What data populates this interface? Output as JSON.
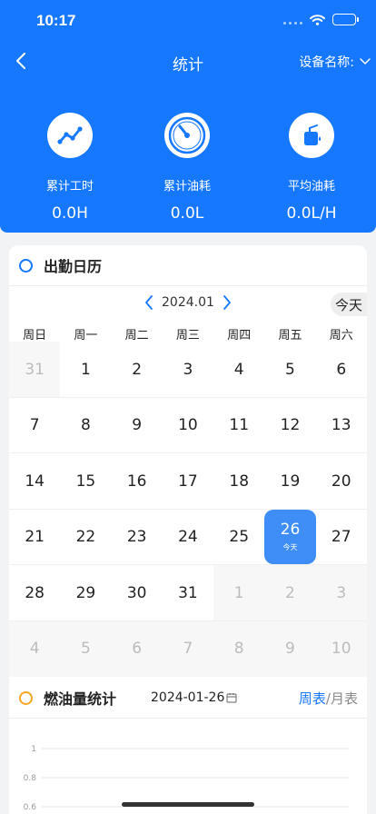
{
  "status": {
    "time": "10:17"
  },
  "nav": {
    "title": "统计",
    "device_label": "设备名称:"
  },
  "stats": [
    {
      "label": "累计工时",
      "value": "0.0H",
      "icon": "trend-icon"
    },
    {
      "label": "累计油耗",
      "value": "0.0L",
      "icon": "gauge-icon"
    },
    {
      "label": "平均油耗",
      "value": "0.0L/H",
      "icon": "fuel-can-icon"
    }
  ],
  "calendar": {
    "title": "出勤日历",
    "month": "2024.01",
    "today_button": "今天",
    "weekdays": [
      "周日",
      "周一",
      "周二",
      "周三",
      "周四",
      "周五",
      "周六"
    ],
    "weeks": [
      [
        {
          "d": "31",
          "o": true
        },
        {
          "d": "1"
        },
        {
          "d": "2"
        },
        {
          "d": "3"
        },
        {
          "d": "4"
        },
        {
          "d": "5"
        },
        {
          "d": "6"
        }
      ],
      [
        {
          "d": "7"
        },
        {
          "d": "8"
        },
        {
          "d": "9"
        },
        {
          "d": "10"
        },
        {
          "d": "11"
        },
        {
          "d": "12"
        },
        {
          "d": "13"
        }
      ],
      [
        {
          "d": "14"
        },
        {
          "d": "15"
        },
        {
          "d": "16"
        },
        {
          "d": "17"
        },
        {
          "d": "18"
        },
        {
          "d": "19"
        },
        {
          "d": "20"
        }
      ],
      [
        {
          "d": "21"
        },
        {
          "d": "22"
        },
        {
          "d": "23"
        },
        {
          "d": "24"
        },
        {
          "d": "25"
        },
        {
          "d": "26",
          "today": true,
          "sub": "今天"
        },
        {
          "d": "27"
        }
      ],
      [
        {
          "d": "28"
        },
        {
          "d": "29"
        },
        {
          "d": "30"
        },
        {
          "d": "31"
        },
        {
          "d": "1",
          "o": true
        },
        {
          "d": "2",
          "o": true
        },
        {
          "d": "3",
          "o": true
        }
      ],
      [
        {
          "d": "4",
          "o": true
        },
        {
          "d": "5",
          "o": true
        },
        {
          "d": "6",
          "o": true
        },
        {
          "d": "7",
          "o": true
        },
        {
          "d": "8",
          "o": true
        },
        {
          "d": "9",
          "o": true
        },
        {
          "d": "10",
          "o": true
        }
      ]
    ]
  },
  "fuel": {
    "title": "燃油量统计",
    "date": "2024-01-26",
    "week_label": "周表",
    "separator": "/",
    "month_label": "月表"
  },
  "chart_data": {
    "type": "line",
    "yticks": [
      "1",
      "0.8",
      "0.6"
    ],
    "ylim": [
      0,
      1
    ],
    "series": []
  },
  "colors": {
    "primary": "#1677ff",
    "today": "#3f8ef7",
    "orange": "#f5a623"
  }
}
